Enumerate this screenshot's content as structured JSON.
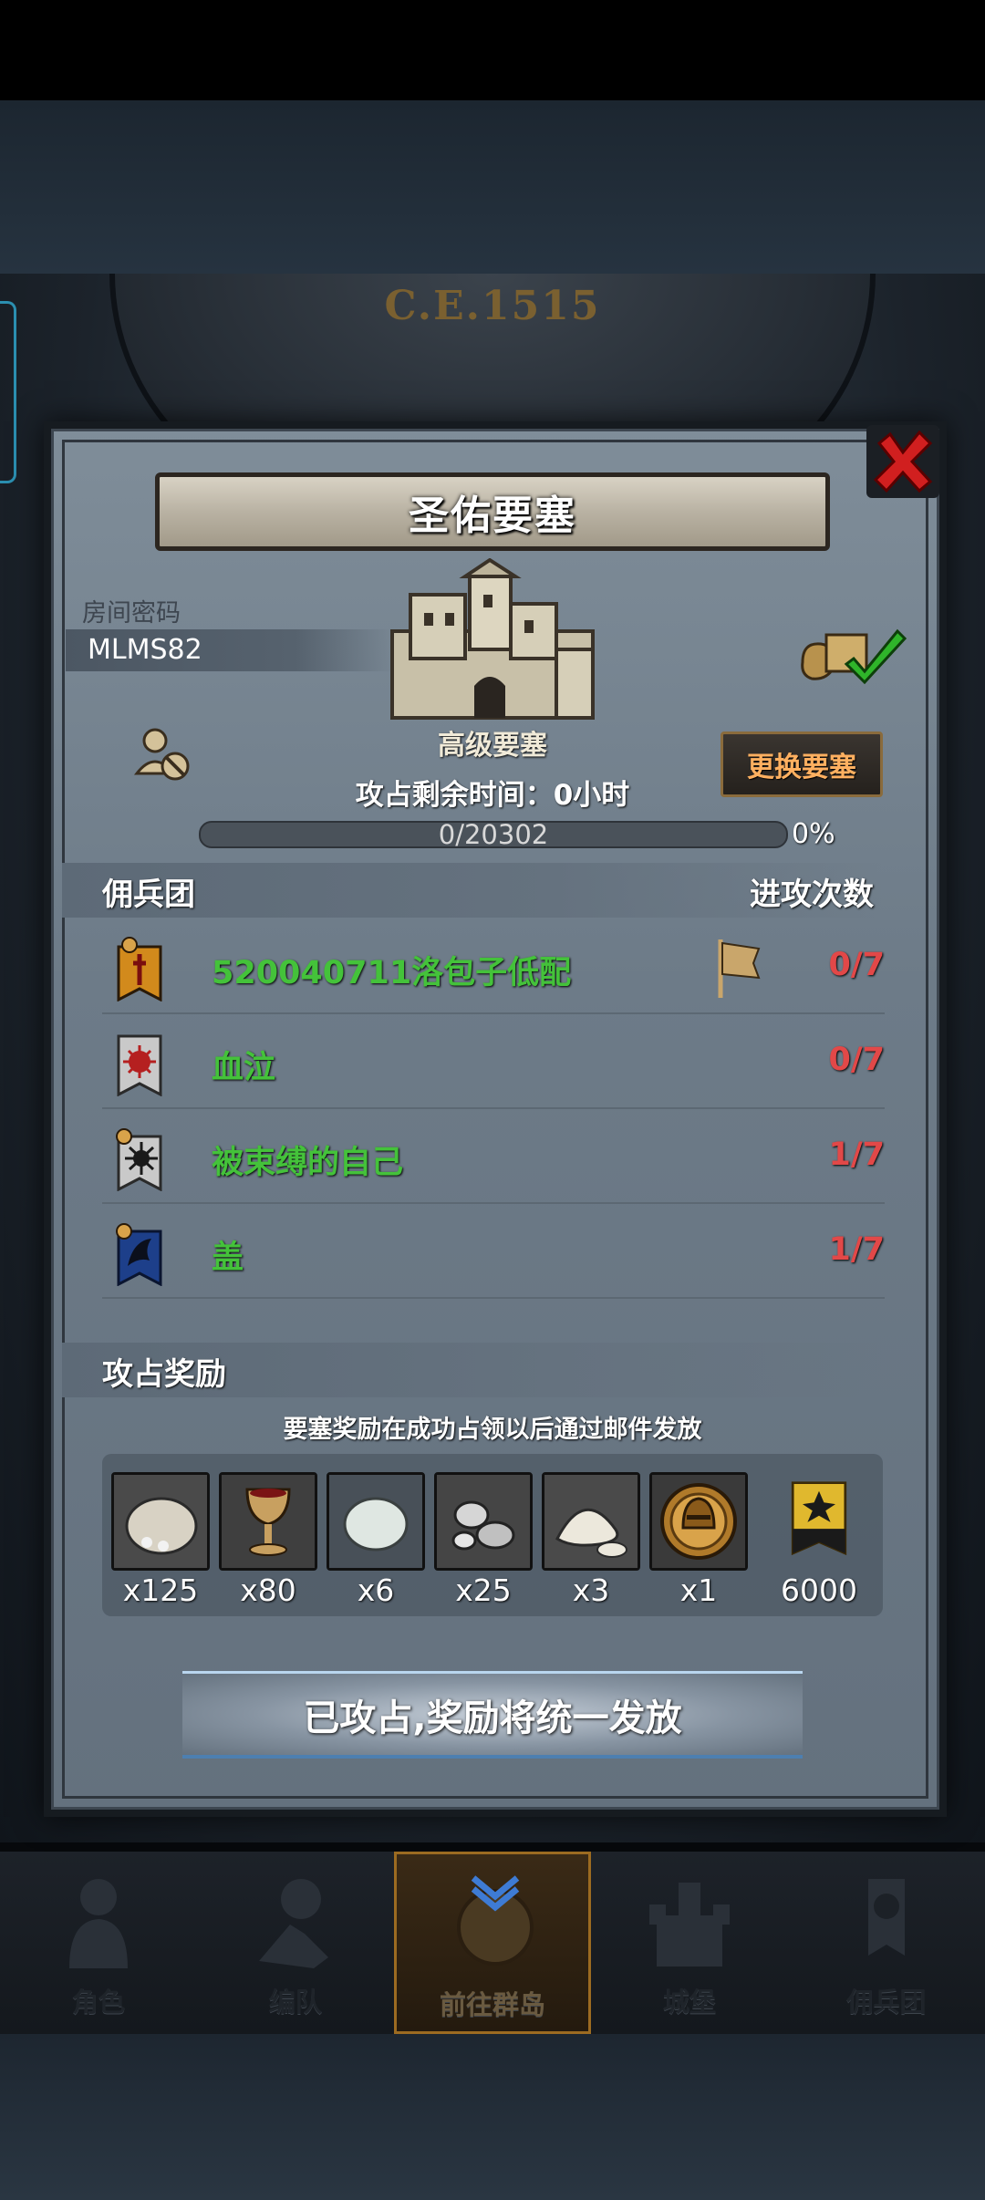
{
  "background": {
    "era": "C.E.1515"
  },
  "panel": {
    "title": "圣佑要塞",
    "room": {
      "label": "房间密码",
      "code": "MLMS82"
    },
    "fortress": {
      "type": "高级要塞",
      "icon": "castle-icon"
    },
    "change_button": "更换要塞",
    "capture_time": "攻占剩余时间：0小时",
    "progress": {
      "text": "0/20302",
      "percent_text": "0%",
      "fraction": 0
    },
    "mercenary_header": {
      "left": "佣兵团",
      "right": "进攻次数"
    },
    "mercenaries": [
      {
        "name": "520040711洛包子低配",
        "attacks": "0/7",
        "emblem_color": "#d28a1c",
        "flag": true
      },
      {
        "name": "血泣",
        "attacks": "0/7",
        "emblem_color": "#c9c9c9",
        "flag": false
      },
      {
        "name": "被束缚的自己",
        "attacks": "1/7",
        "emblem_color": "#c9c9c9",
        "flag": false
      },
      {
        "name": "盖",
        "attacks": "1/7",
        "emblem_color": "#1d3f8a",
        "flag": false
      }
    ],
    "rewards_header": "攻占奖励",
    "rewards_note": "要塞奖励在成功占领以后通过邮件发放",
    "rewards": [
      {
        "icon": "grain-sack-icon",
        "qty": "x125"
      },
      {
        "icon": "goblet-icon",
        "qty": "x80"
      },
      {
        "icon": "stone-icon",
        "qty": "x6"
      },
      {
        "icon": "silver-ore-icon",
        "qty": "x25"
      },
      {
        "icon": "salt-pile-icon",
        "qty": "x3"
      },
      {
        "icon": "helmet-medal-icon",
        "qty": "x1"
      },
      {
        "icon": "guild-banner-icon",
        "qty": "6000"
      }
    ],
    "claim_banner": "已攻占,奖励将统一发放"
  },
  "nav": [
    {
      "label": "角色",
      "icon": "knight-icon"
    },
    {
      "label": "编队",
      "icon": "formation-icon"
    },
    {
      "label": "前往群岛",
      "icon": "compass-icon"
    },
    {
      "label": "城堡",
      "icon": "castle-nav-icon"
    },
    {
      "label": "佣兵团",
      "icon": "mercenary-icon"
    }
  ],
  "colors": {
    "name_green": "#44c23a",
    "attack_red": "#e24848",
    "change_btn_text": "#ffb060",
    "active_nav_border": "#9c6b21"
  }
}
